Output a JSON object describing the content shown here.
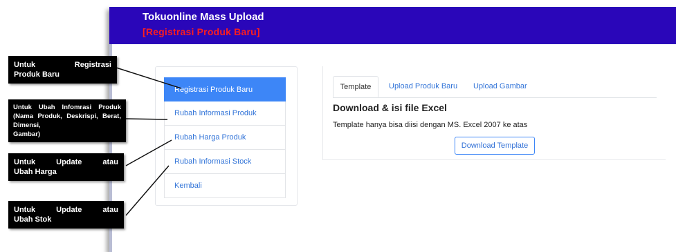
{
  "header": {
    "title": "Tokuonline Mass Upload",
    "subtitle": "[Registrasi Produk Baru]"
  },
  "menu": {
    "items": [
      {
        "label": "Registrasi Produk Baru",
        "active": true
      },
      {
        "label": "Rubah Informasi Produk"
      },
      {
        "label": "Rubah Harga Produk"
      },
      {
        "label": "Rubah Informasi Stock"
      },
      {
        "label": "Kembali"
      }
    ]
  },
  "tabs": [
    {
      "label": "Template",
      "active": true
    },
    {
      "label": "Upload Produk Baru"
    },
    {
      "label": "Upload Gambar"
    }
  ],
  "content": {
    "heading": "Download & isi file Excel",
    "description": "Template hanya bisa diisi dengan MS. Excel 2007 ke atas",
    "download_button": "Download Template"
  },
  "callouts": [
    {
      "line1": "Untuk Registrasi",
      "line2": "Produk Baru"
    },
    {
      "line1": "Untuk Ubah Infomrasi Produk (Nama Produk, Deskrispi, Berat, Dimensi,",
      "line2": "Gambar)"
    },
    {
      "line1": "Untuk Update atau",
      "line2": "Ubah Harga"
    },
    {
      "line1": "Untuk Update atau",
      "line2": "Ubah Stok"
    }
  ],
  "colors": {
    "header_bg": "#2a06b9",
    "subtitle": "#ff1e1e",
    "accent": "#3d86f7",
    "link": "#3274d8",
    "callout_bg": "#000000"
  }
}
